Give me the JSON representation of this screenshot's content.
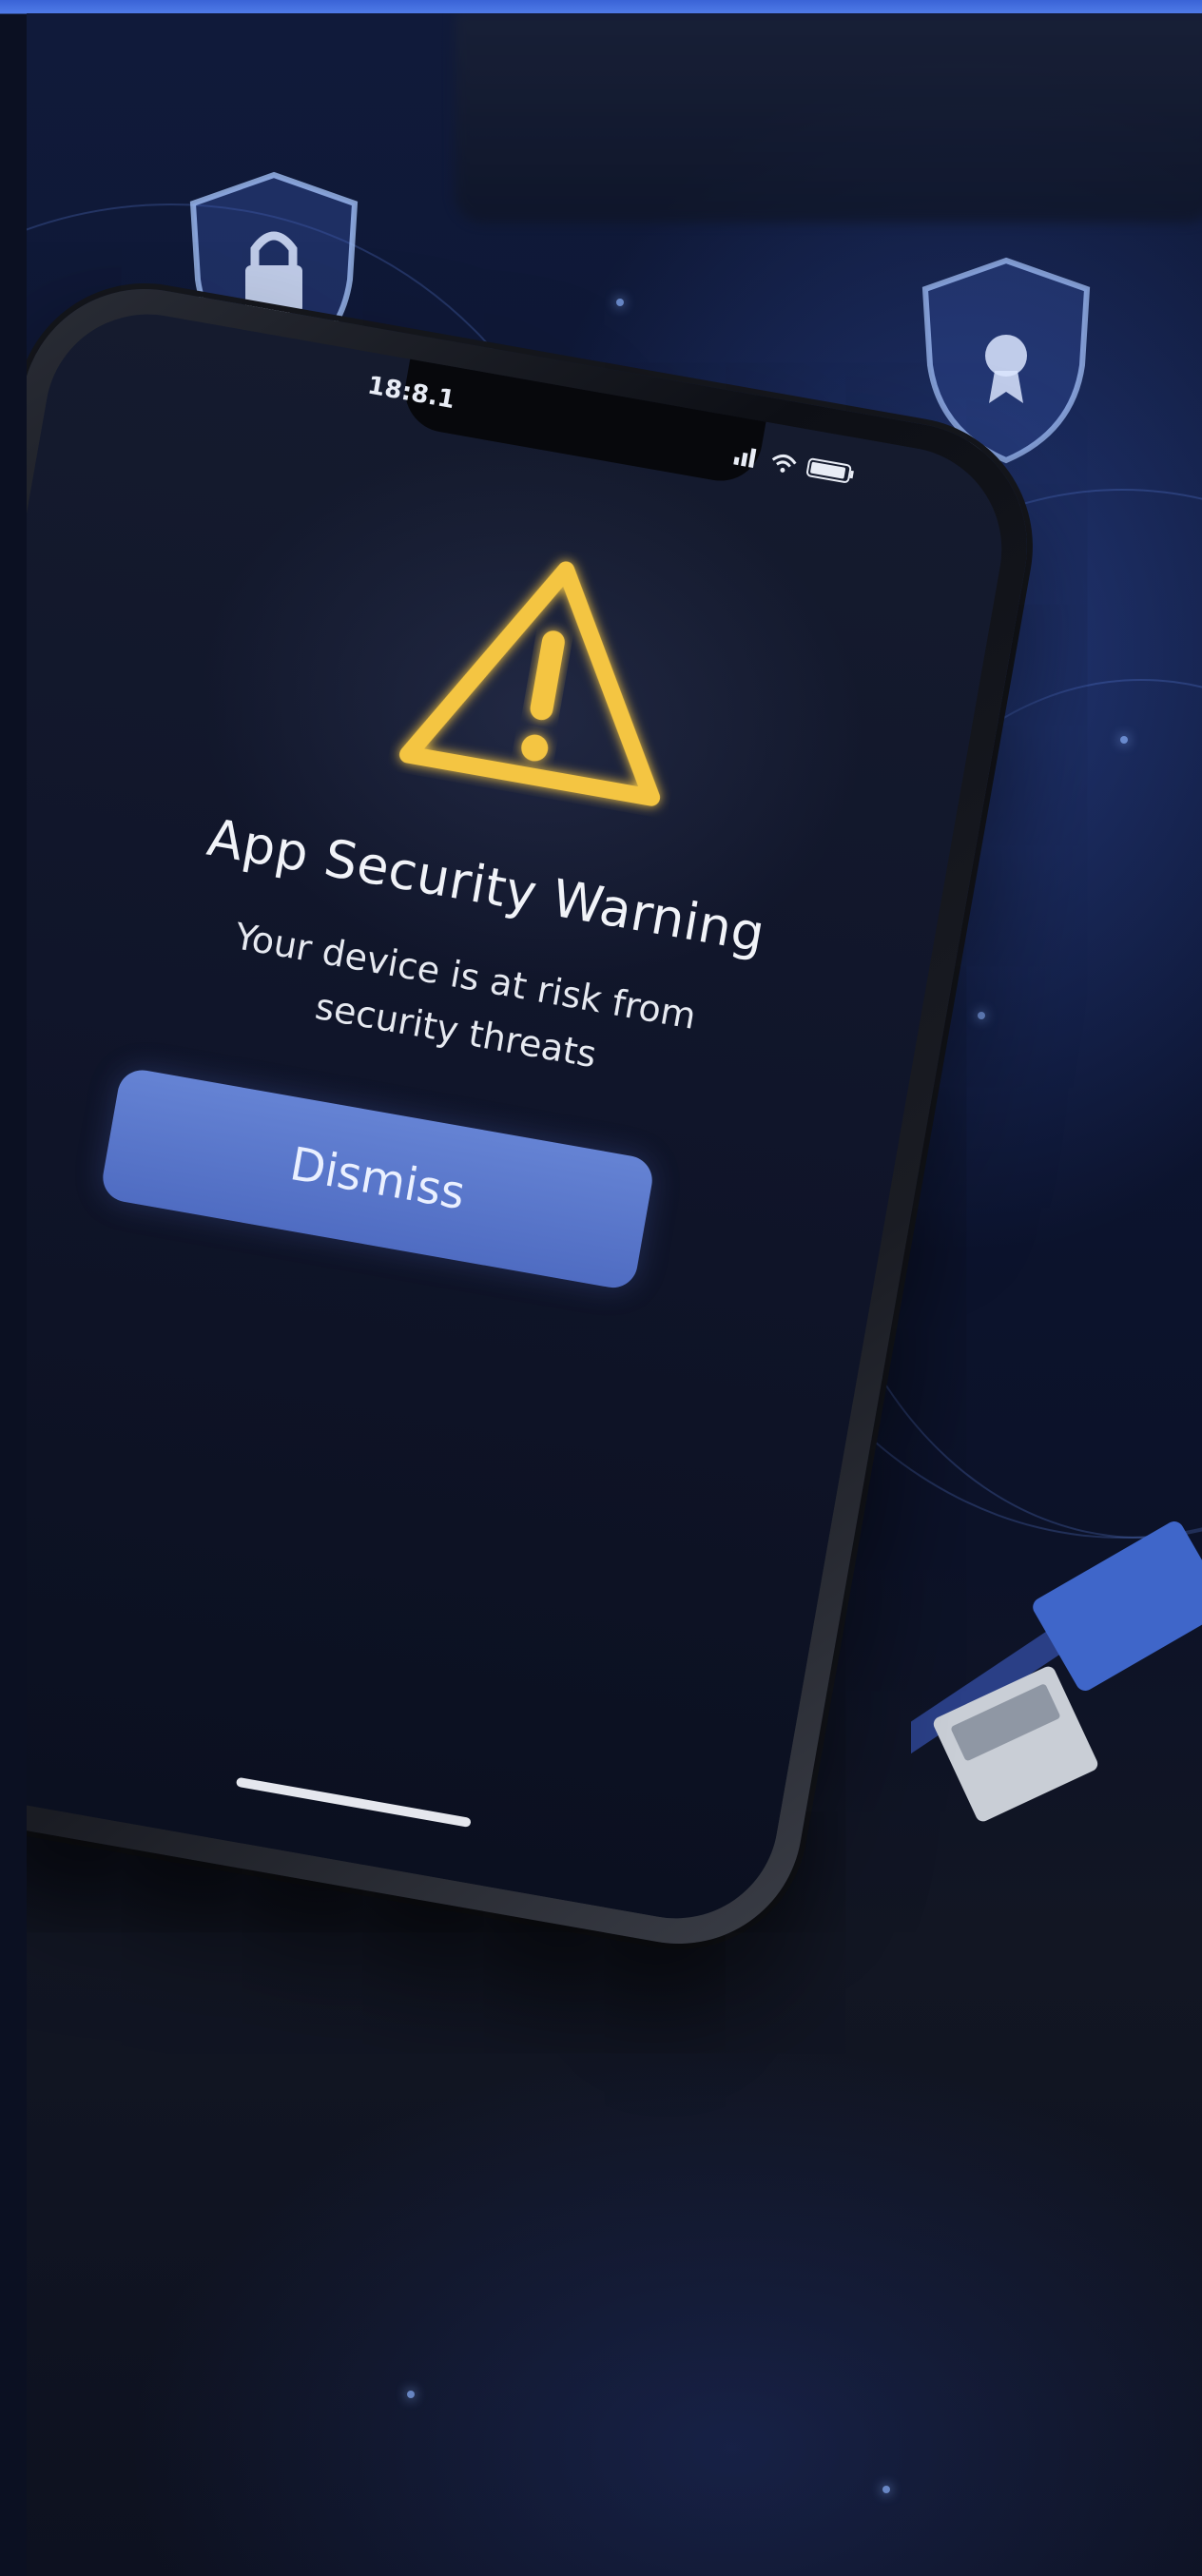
{
  "status_bar": {
    "time": "18:8.1",
    "signal_icon": "signal-bars-icon",
    "wifi_icon": "wifi-icon",
    "battery_icon": "battery-icon"
  },
  "alert": {
    "icon": "warning-triangle-icon",
    "title": "App Security Warning",
    "message_line1": "Your device is at risk from",
    "message_line2": "security threats",
    "dismiss_label": "Dismiss"
  },
  "colors": {
    "warning": "#f4c542",
    "button": "#5b78cc",
    "frame_border": "#4f7be8"
  },
  "background_icons": [
    "lock-shield-icon",
    "badge-shield-icon",
    "shield-icon",
    "ethernet-cable-icon"
  ]
}
